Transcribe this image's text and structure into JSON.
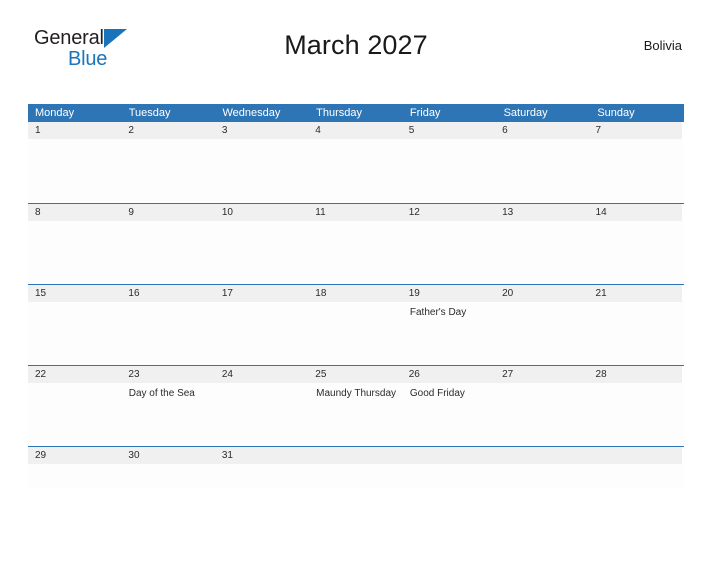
{
  "brand": {
    "name_part1": "General",
    "name_part2": "Blue",
    "flag_icon": "triangle-flag-icon",
    "accent_color": "#1a74bb"
  },
  "header": {
    "title": "March 2027",
    "country": "Bolivia"
  },
  "calendar": {
    "month": "March",
    "year": "2027",
    "header_bg": "#2e75b6",
    "date_band_bg": "#f0f0f0",
    "weekdays": [
      "Monday",
      "Tuesday",
      "Wednesday",
      "Thursday",
      "Friday",
      "Saturday",
      "Sunday"
    ],
    "weeks": [
      {
        "days": [
          {
            "num": "1",
            "events": []
          },
          {
            "num": "2",
            "events": []
          },
          {
            "num": "3",
            "events": []
          },
          {
            "num": "4",
            "events": []
          },
          {
            "num": "5",
            "events": []
          },
          {
            "num": "6",
            "events": []
          },
          {
            "num": "7",
            "events": []
          }
        ]
      },
      {
        "days": [
          {
            "num": "8",
            "events": []
          },
          {
            "num": "9",
            "events": []
          },
          {
            "num": "10",
            "events": []
          },
          {
            "num": "11",
            "events": []
          },
          {
            "num": "12",
            "events": []
          },
          {
            "num": "13",
            "events": []
          },
          {
            "num": "14",
            "events": []
          }
        ]
      },
      {
        "days": [
          {
            "num": "15",
            "events": []
          },
          {
            "num": "16",
            "events": []
          },
          {
            "num": "17",
            "events": []
          },
          {
            "num": "18",
            "events": []
          },
          {
            "num": "19",
            "events": [
              "Father's Day"
            ]
          },
          {
            "num": "20",
            "events": []
          },
          {
            "num": "21",
            "events": []
          }
        ]
      },
      {
        "days": [
          {
            "num": "22",
            "events": []
          },
          {
            "num": "23",
            "events": [
              "Day of the Sea"
            ]
          },
          {
            "num": "24",
            "events": []
          },
          {
            "num": "25",
            "events": [
              "Maundy Thursday"
            ]
          },
          {
            "num": "26",
            "events": [
              "Good Friday"
            ]
          },
          {
            "num": "27",
            "events": []
          },
          {
            "num": "28",
            "events": []
          }
        ]
      },
      {
        "days": [
          {
            "num": "29",
            "events": []
          },
          {
            "num": "30",
            "events": []
          },
          {
            "num": "31",
            "events": []
          },
          {
            "num": "",
            "events": []
          },
          {
            "num": "",
            "events": []
          },
          {
            "num": "",
            "events": []
          },
          {
            "num": "",
            "events": []
          }
        ]
      }
    ]
  }
}
